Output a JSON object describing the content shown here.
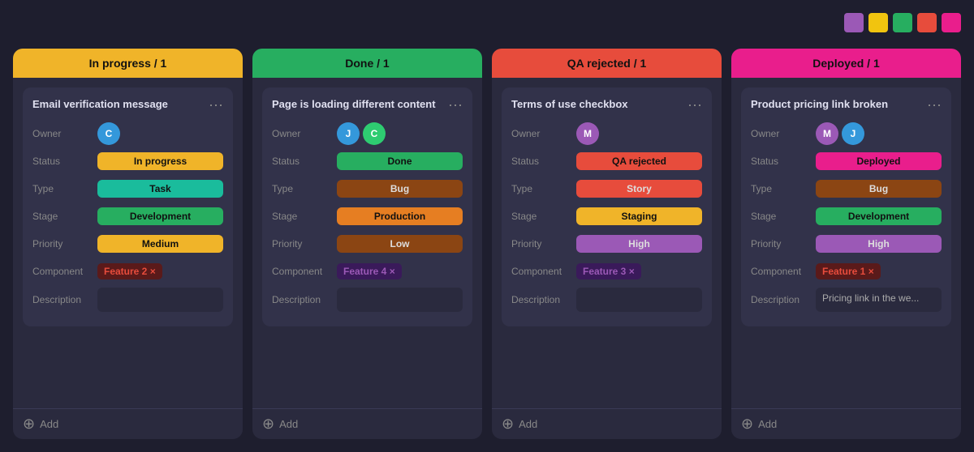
{
  "colorDots": [
    "#9b59b6",
    "#f1c40f",
    "#27ae60",
    "#e74c3c",
    "#e91e8c"
  ],
  "columns": [
    {
      "id": "in-progress",
      "header": "In progress / 1",
      "headerColor": "#f0b429",
      "cards": [
        {
          "title": "Email verification message",
          "owner": [
            {
              "initial": "C",
              "color": "#3498db"
            }
          ],
          "status": {
            "label": "In progress",
            "color": "#f0b429"
          },
          "type": {
            "label": "Task",
            "color": "#1abc9c"
          },
          "stage": {
            "label": "Development",
            "color": "#27ae60"
          },
          "priority": {
            "label": "Medium",
            "color": "#f0b429"
          },
          "component": {
            "label": "Feature 2 ×",
            "color": "#e74c3c",
            "bg": "#5a1a1a"
          },
          "description": ""
        }
      ],
      "addLabel": "Add"
    },
    {
      "id": "done",
      "header": "Done / 1",
      "headerColor": "#27ae60",
      "cards": [
        {
          "title": "Page is loading different content",
          "owner": [
            {
              "initial": "J",
              "color": "#3498db"
            },
            {
              "initial": "C",
              "color": "#2ecc71"
            }
          ],
          "status": {
            "label": "Done",
            "color": "#27ae60"
          },
          "type": {
            "label": "Bug",
            "color": "#8B4513"
          },
          "stage": {
            "label": "Production",
            "color": "#e67e22"
          },
          "priority": {
            "label": "Low",
            "color": "#8B4513"
          },
          "component": {
            "label": "Feature 4 ×",
            "color": "#9b59b6",
            "bg": "#3a1a5a"
          },
          "description": ""
        }
      ],
      "addLabel": "Add"
    },
    {
      "id": "qa-rejected",
      "header": "QA rejected / 1",
      "headerColor": "#e74c3c",
      "cards": [
        {
          "title": "Terms of use checkbox",
          "owner": [
            {
              "initial": "M",
              "color": "#9b59b6"
            }
          ],
          "status": {
            "label": "QA rejected",
            "color": "#e74c3c"
          },
          "type": {
            "label": "Story",
            "color": "#e74c3c"
          },
          "stage": {
            "label": "Staging",
            "color": "#f0b429"
          },
          "priority": {
            "label": "High",
            "color": "#9b59b6"
          },
          "component": {
            "label": "Feature 3 ×",
            "color": "#9b59b6",
            "bg": "#3a1a5a"
          },
          "description": ""
        }
      ],
      "addLabel": "Add"
    },
    {
      "id": "deployed",
      "header": "Deployed / 1",
      "headerColor": "#e91e8c",
      "cards": [
        {
          "title": "Product pricing link broken",
          "owner": [
            {
              "initial": "M",
              "color": "#9b59b6"
            },
            {
              "initial": "J",
              "color": "#3498db"
            }
          ],
          "status": {
            "label": "Deployed",
            "color": "#e91e8c"
          },
          "type": {
            "label": "Bug",
            "color": "#8B4513"
          },
          "stage": {
            "label": "Development",
            "color": "#27ae60"
          },
          "priority": {
            "label": "High",
            "color": "#9b59b6"
          },
          "component": {
            "label": "Feature 1 ×",
            "color": "#e74c3c",
            "bg": "#5a1a1a"
          },
          "description": "Pricing link in the we..."
        }
      ],
      "addLabel": "Add"
    }
  ]
}
